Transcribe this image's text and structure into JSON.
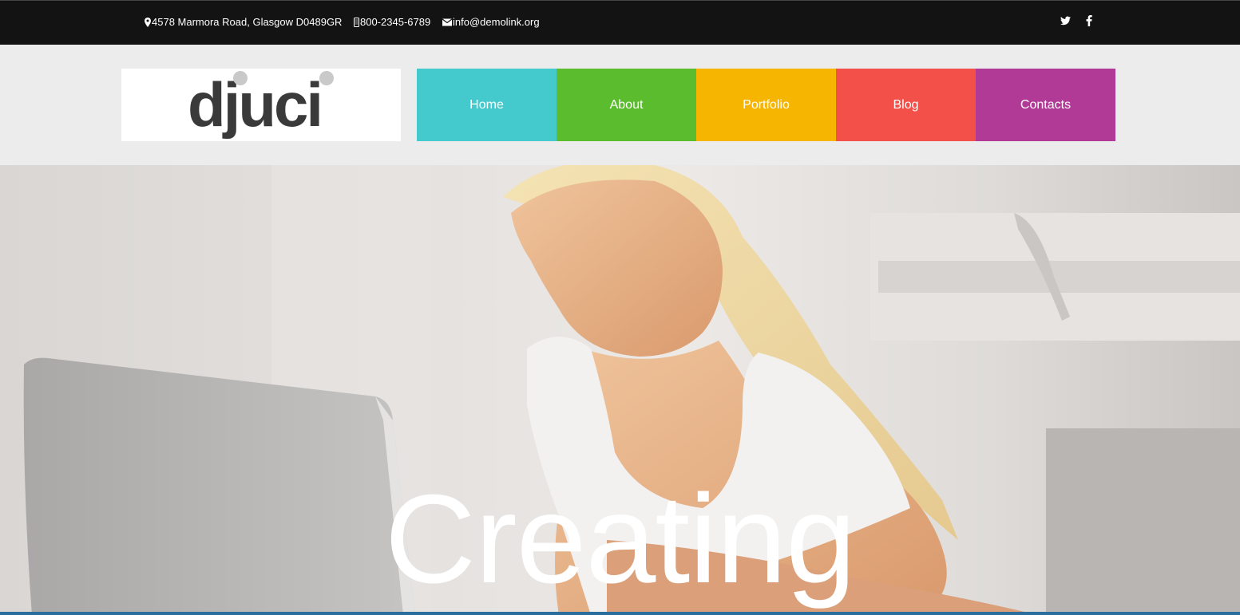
{
  "topbar": {
    "address": "4578 Marmora Road, Glasgow D0489GR",
    "phone": "800-2345-6789",
    "email": "info@demolink.org",
    "social": [
      {
        "icon": "twitter-icon"
      },
      {
        "icon": "facebook-icon"
      }
    ]
  },
  "logo": {
    "text": "djuci"
  },
  "nav": {
    "items": [
      {
        "label": "Home",
        "color": "#44c9cd"
      },
      {
        "label": "About",
        "color": "#5bbc2e"
      },
      {
        "label": "Portfolio",
        "color": "#f6b500"
      },
      {
        "label": "Blog",
        "color": "#f4504a"
      },
      {
        "label": "Contacts",
        "color": "#b03a96"
      }
    ]
  },
  "hero": {
    "headline": "Creating"
  }
}
